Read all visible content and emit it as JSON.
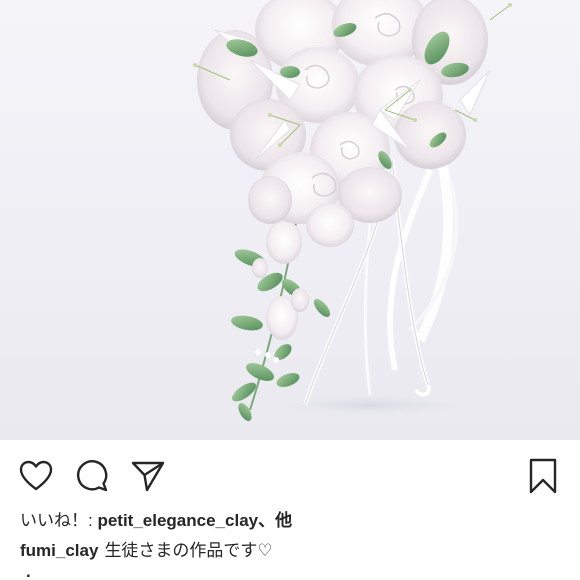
{
  "post": {
    "photo_alt": "cascade bouquet of white clay roses and lilies on a white stand",
    "likes": {
      "prefix": "いいね！: ",
      "user": "petit_elegance_clay",
      "suffix": "、他"
    },
    "caption": {
      "owner": "fumi_clay",
      "text": "生徒さまの作品です♡",
      "extra_line": "."
    },
    "actions": {
      "like_icon": "heart-icon",
      "comment_icon": "comment-icon",
      "share_icon": "send-icon",
      "save_icon": "bookmark-icon"
    }
  }
}
